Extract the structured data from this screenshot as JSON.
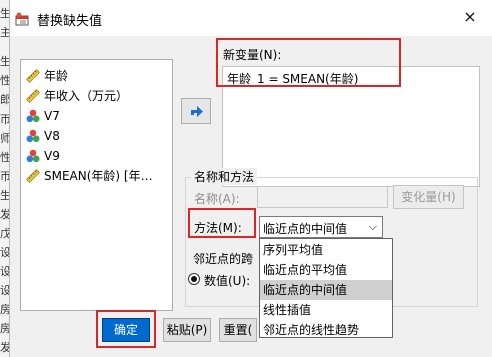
{
  "background_column": [
    "生",
    "主",
    "生",
    "性",
    "郎",
    "帀",
    "师",
    "性",
    "帀",
    "生",
    "发",
    "戊",
    "设",
    "设",
    "设",
    "房",
    "房",
    "发"
  ],
  "dialog": {
    "title": "替换缺失值",
    "close_symbol": "×"
  },
  "variables": [
    {
      "label": "年龄",
      "icon": "scale-ruler-icon"
    },
    {
      "label": "年收入（万元）",
      "icon": "scale-ruler-icon"
    },
    {
      "label": "V7",
      "icon": "nominal-balls-icon"
    },
    {
      "label": "V8",
      "icon": "nominal-balls-icon"
    },
    {
      "label": "V9",
      "icon": "nominal-balls-icon"
    },
    {
      "label": "SMEAN(年龄) [年…",
      "icon": "scale-ruler-icon"
    }
  ],
  "new_variable": {
    "label": "新变量(N):",
    "expression": "年龄_1 = SMEAN(年龄)"
  },
  "name_method": {
    "group_title": "名称和方法",
    "name_label": "名称(A):",
    "name_value": "",
    "change_button": "变化量(H)",
    "method_label": "方法(M):",
    "method_value": "临近点的中间值",
    "options": [
      "序列平均值",
      "临近点的平均值",
      "临近点的中间值",
      "线性插值",
      "邻近点的线性趋势"
    ],
    "selected_option": "临近点的中间值",
    "span_label": "邻近点的跨",
    "number_label": "数值(U):"
  },
  "buttons": {
    "ok": "确定",
    "paste": "粘贴(P)",
    "reset": "重置("
  },
  "colors": {
    "primary_button": "#0069ce",
    "highlight_border": "#d8272a",
    "arrow_blue": "#1f6fd1"
  }
}
